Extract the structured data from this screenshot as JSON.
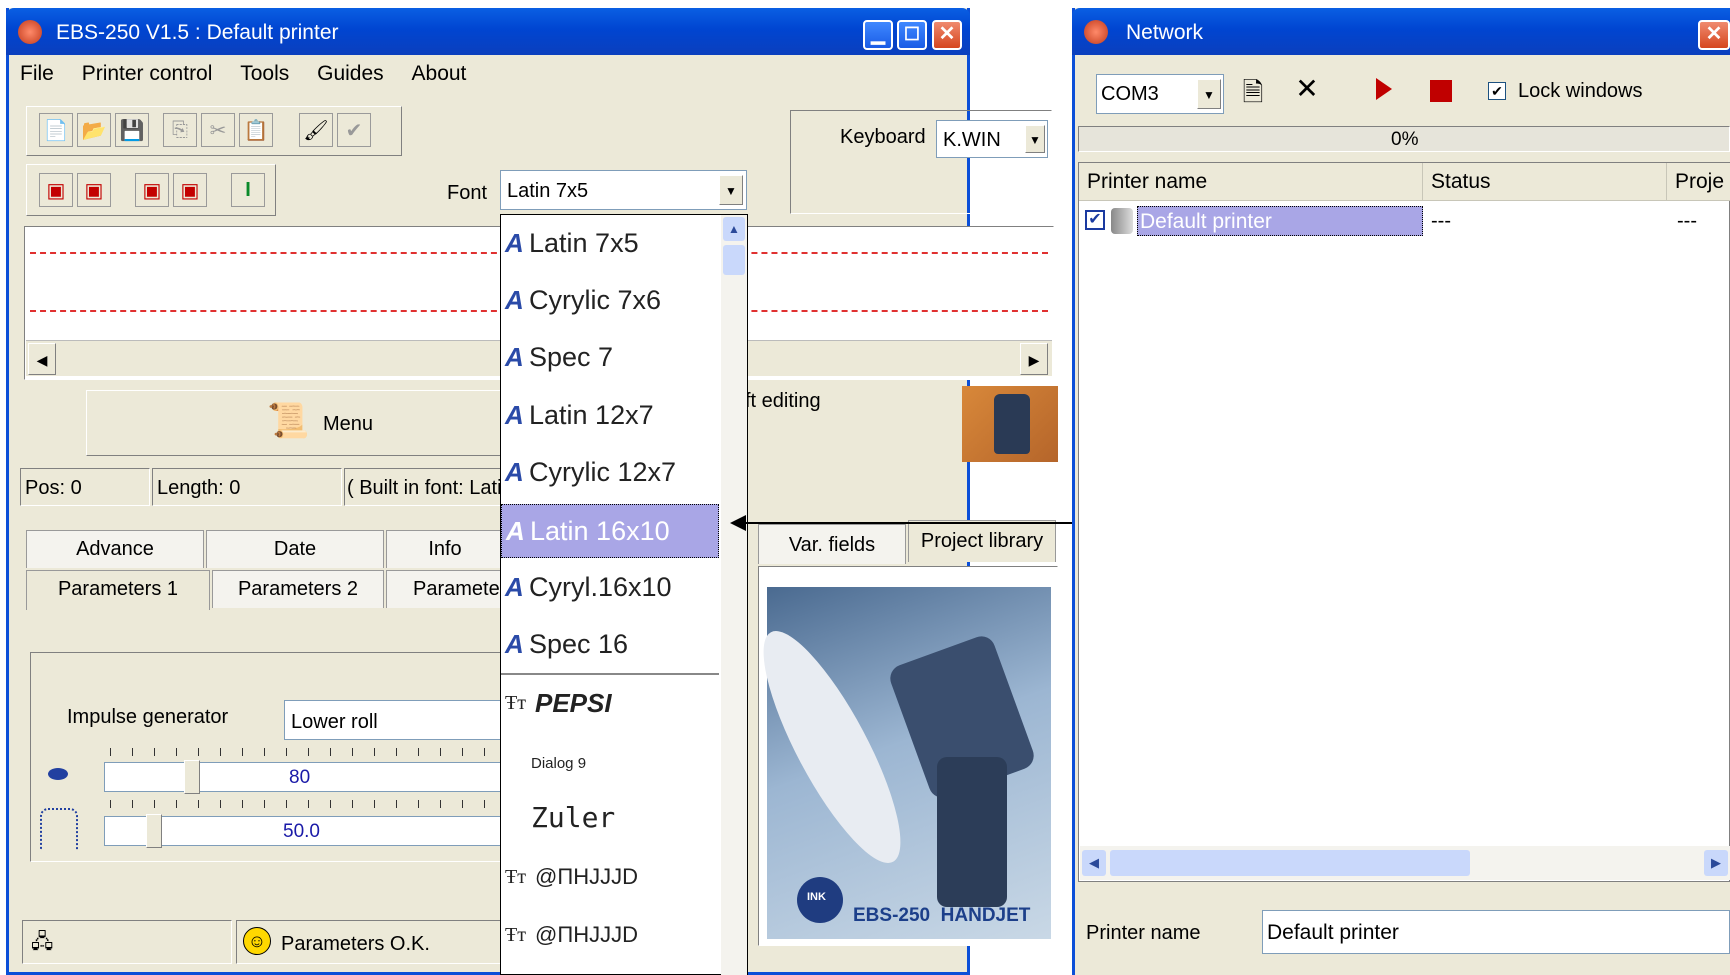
{
  "main": {
    "title": "EBS-250 V1.5  :  Default printer",
    "menu": [
      "File",
      "Printer control",
      "Tools",
      "Guides",
      "About"
    ],
    "keyboard_label": "Keyboard",
    "keyboard_value": "K.WIN",
    "font_label": "Font",
    "font_value": "Latin 7x5",
    "menu_button": "Menu",
    "status": {
      "pos": "Pos: 0",
      "length": "Length: 0",
      "builtin": "( Built in font: Lati"
    },
    "soft_editing": "ft editing",
    "tabs_row1": [
      "Advance",
      "Date",
      "Info"
    ],
    "tabs_row2": [
      "Parameters 1",
      "Parameters 2",
      "Paramete"
    ],
    "right_tabs": [
      "Var. fields",
      "Project library"
    ],
    "impulse_label": "Impulse generator",
    "impulse_value": "Lower roll",
    "slider1_value": "80",
    "slider2_value": "50.0",
    "status_bottom": "Parameters O.K.",
    "product_caption": "EBS-250  HANDJET",
    "product_ink": "INK"
  },
  "font_dropdown": {
    "items": [
      "Latin 7x5",
      "Cyrylic 7x6",
      "Spec 7",
      "Latin 12x7",
      "Cyrylic 12x7",
      "Latin 16x10",
      "Cyryl.16x10",
      "Spec 16"
    ],
    "selected": "Latin 16x10",
    "system_fonts": [
      "PEPSI",
      "Dialog 9",
      "Zuler",
      "@ΠΗJJJD",
      "@ΠΗJJJD"
    ]
  },
  "network": {
    "title": "Network",
    "port": "COM3",
    "lock_label": "Lock windows",
    "progress": "0%",
    "columns": [
      "Printer name",
      "Status",
      "Proje"
    ],
    "row": {
      "name": "Default printer",
      "status": "---",
      "project": "---"
    },
    "printer_name_label": "Printer name",
    "printer_name_value": "Default printer"
  },
  "colors": {
    "title_blue": "#0a5fe3",
    "selection": "#a9a6e6",
    "window_bg": "#ece9d8"
  }
}
